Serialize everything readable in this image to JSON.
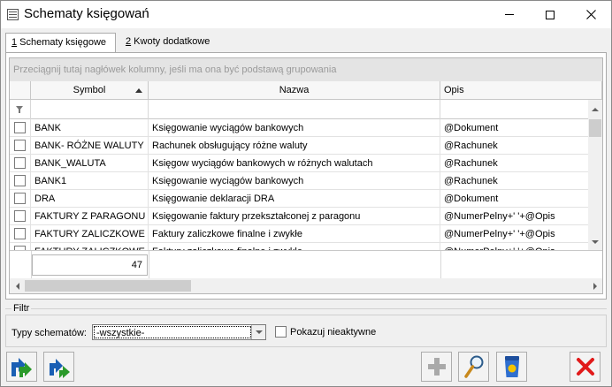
{
  "window": {
    "title": "Schematy księgowań"
  },
  "tabs": [
    {
      "mnemonic": "1",
      "label": " Schematy księgowe",
      "active": true
    },
    {
      "mnemonic": "2",
      "label": " Kwoty dodatkowe",
      "active": false
    }
  ],
  "grid": {
    "group_panel_text": "Przeciągnij tutaj nagłówek kolumny, jeśli ma ona być podstawą grupowania",
    "columns": [
      "Symbol",
      "Nazwa",
      "Opis"
    ],
    "sort_column": "Symbol",
    "sort_direction": "ascending",
    "rows": [
      {
        "symbol": "BANK",
        "nazwa": "Księgowanie wyciągów bankowych",
        "opis": "@Dokument"
      },
      {
        "symbol": "BANK- RÓŻNE WALUTY",
        "nazwa": "Rachunek obsługujący różne waluty",
        "opis": "@Rachunek"
      },
      {
        "symbol": "BANK_WALUTA",
        "nazwa": "Księgow wyciągów bankowych w różnych walutach",
        "opis": "@Rachunek"
      },
      {
        "symbol": "BANK1",
        "nazwa": "Księgowanie wyciągów bankowych",
        "opis": "@Rachunek"
      },
      {
        "symbol": "DRA",
        "nazwa": "Księgowanie deklaracji DRA",
        "opis": "@Dokument"
      },
      {
        "symbol": "FAKTURY Z PARAGONU",
        "nazwa": "Księgowanie faktury przekształconej z paragonu",
        "opis": "@NumerPelny+' '+@Opis"
      },
      {
        "symbol": "FAKTURY ZALICZKOWE",
        "nazwa": "Faktury zaliczkowe finalne i zwykłe",
        "opis": "@NumerPelny+' '+@Opis"
      },
      {
        "symbol": "FAKTURY ZALICZKOWE",
        "nazwa": "Faktury zaliczkowe finalne i zwykłe",
        "opis": "@NumerPelny+' '+@Opis"
      }
    ],
    "record_count": "47"
  },
  "filter": {
    "legend": "Filtr",
    "type_label": "Typy schematów:",
    "type_value": "-wszystkie-",
    "show_inactive_label": "Pokazuj nieaktywne",
    "show_inactive_checked": false
  },
  "toolbar": {
    "buttons": [
      "export-icon",
      "import-icon",
      "add-icon",
      "preview-icon",
      "delete-icon",
      "close-icon"
    ]
  },
  "colors": {
    "accent_red": "#e11a1a",
    "arrow_green": "#2b9a2b",
    "arrow_blue": "#1a5fb4",
    "bin_blue": "#2f6fd0",
    "bin_yellow": "#f5c400"
  }
}
